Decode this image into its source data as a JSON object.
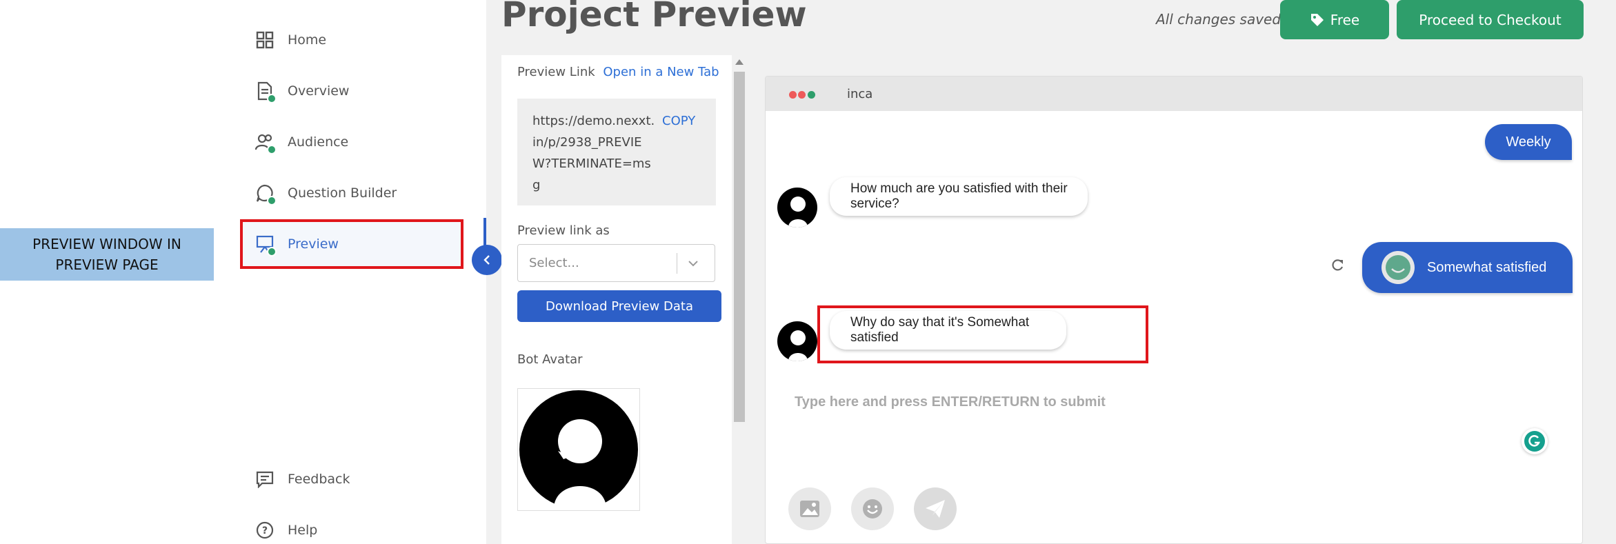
{
  "callout": {
    "text": "PREVIEW WINDOW IN PREVIEW PAGE"
  },
  "nav": {
    "items": [
      {
        "label": "Home",
        "icon": "grid-icon"
      },
      {
        "label": "Overview",
        "icon": "document-icon"
      },
      {
        "label": "Audience",
        "icon": "users-icon"
      },
      {
        "label": "Question Builder",
        "icon": "chat-question-icon"
      },
      {
        "label": "Preview",
        "icon": "presentation-icon"
      }
    ],
    "footer": [
      {
        "label": "Feedback",
        "icon": "feedback-icon"
      },
      {
        "label": "Help",
        "icon": "help-icon"
      }
    ]
  },
  "header": {
    "title": "Project Preview",
    "status": "All changes saved",
    "free_label": "Free",
    "checkout_label": "Proceed to Checkout"
  },
  "settings": {
    "preview_link_label": "Preview Link",
    "open_new_tab": "Open in a New Tab",
    "url": "https://demo.nexxt.in/p/2938_PREVIEW?TERMINATE=msg",
    "copy_label": "COPY",
    "preview_as_label": "Preview link as",
    "select_placeholder": "Select...",
    "download_label": "Download Preview Data",
    "bot_avatar_label": "Bot Avatar"
  },
  "chat": {
    "bot_name": "inca",
    "messages": [
      {
        "from": "user",
        "text": "Weekly"
      },
      {
        "from": "bot",
        "text": "How much are you satisfied with their service?"
      },
      {
        "from": "user",
        "text": "Somewhat satisfied"
      },
      {
        "from": "bot",
        "text": "Why do say that it's Somewhat satisfied"
      }
    ],
    "input_placeholder": "Type here and press ENTER/RETURN to submit"
  },
  "colors": {
    "accent_blue": "#2d5fc7",
    "accent_green": "#2e9e6b",
    "highlight_red": "#e0161b",
    "callout_blue": "#9dc3e6"
  }
}
